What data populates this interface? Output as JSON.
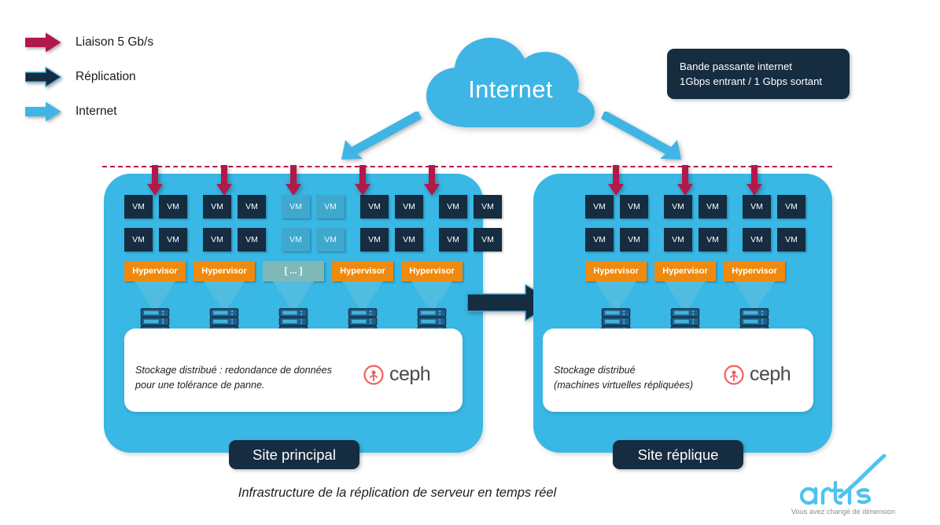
{
  "legend": {
    "items": [
      {
        "label": "Liaison 5 Gb/s",
        "color": "#b3184a",
        "icon": "arrow-right-icon"
      },
      {
        "label": "Réplication",
        "color": "#152c41",
        "icon": "arrow-right-icon"
      },
      {
        "label": "Internet",
        "color": "#3fb5e5",
        "icon": "arrow-right-icon"
      }
    ]
  },
  "cloud": {
    "label": "Internet",
    "color": "#3fb5e5"
  },
  "bandwidth": {
    "line1": "Bande passante internet",
    "line2": "1Gbps entrant / 1 Gbps sortant"
  },
  "sites": {
    "left": {
      "label": "Site principal",
      "vm_label": "VM",
      "vm_row1": [
        {
          "label": "VM",
          "faded": false
        },
        {
          "label": "VM",
          "faded": false
        },
        {
          "label": "VM",
          "faded": false
        },
        {
          "label": "VM",
          "faded": false
        },
        {
          "label": "VM",
          "faded": true
        },
        {
          "label": "VM",
          "faded": true
        },
        {
          "label": "VM",
          "faded": false
        },
        {
          "label": "VM",
          "faded": false
        },
        {
          "label": "VM",
          "faded": false
        },
        {
          "label": "VM",
          "faded": false
        }
      ],
      "vm_row2": [
        {
          "label": "VM",
          "faded": false
        },
        {
          "label": "VM",
          "faded": false
        },
        {
          "label": "VM",
          "faded": false
        },
        {
          "label": "VM",
          "faded": false
        },
        {
          "label": "VM",
          "faded": true
        },
        {
          "label": "VM",
          "faded": true
        },
        {
          "label": "VM",
          "faded": false
        },
        {
          "label": "VM",
          "faded": false
        },
        {
          "label": "VM",
          "faded": false
        },
        {
          "label": "VM",
          "faded": false
        }
      ],
      "hypervisors": [
        {
          "label": "Hypervisor",
          "muted": false
        },
        {
          "label": "Hypervisor",
          "muted": false
        },
        {
          "label": "[ ... ]",
          "muted": true
        },
        {
          "label": "Hypervisor",
          "muted": false
        },
        {
          "label": "Hypervisor",
          "muted": false
        }
      ],
      "server_count": 5,
      "red_arrow_count": 5,
      "storage_text": "Stockage distribué : redondance de données\npour une tolérance de panne.",
      "ceph_label": "ceph"
    },
    "right": {
      "label": "Site réplique",
      "vm_label": "VM",
      "vm_row1": [
        {
          "label": "VM",
          "faded": false
        },
        {
          "label": "VM",
          "faded": false
        },
        {
          "label": "VM",
          "faded": false
        },
        {
          "label": "VM",
          "faded": false
        },
        {
          "label": "VM",
          "faded": false
        },
        {
          "label": "VM",
          "faded": false
        }
      ],
      "vm_row2": [
        {
          "label": "VM",
          "faded": false
        },
        {
          "label": "VM",
          "faded": false
        },
        {
          "label": "VM",
          "faded": false
        },
        {
          "label": "VM",
          "faded": false
        },
        {
          "label": "VM",
          "faded": false
        },
        {
          "label": "VM",
          "faded": false
        }
      ],
      "hypervisors": [
        {
          "label": "Hypervisor",
          "muted": false
        },
        {
          "label": "Hypervisor",
          "muted": false
        },
        {
          "label": "Hypervisor",
          "muted": false
        }
      ],
      "server_count": 3,
      "red_arrow_count": 3,
      "storage_text": "Stockage distribué\n(machines virtuelles répliquées)",
      "ceph_label": "ceph"
    }
  },
  "replication_arrow": {
    "name": "replication-arrow",
    "color": "#152c41"
  },
  "caption": "Infrastructure de la réplication de serveur en temps réel",
  "logo": {
    "name": "artis",
    "tagline": "Vous avez changé de dimension",
    "color": "#3fb5e5"
  },
  "colors": {
    "cyan": "#39b7e5",
    "cloud_cyan": "#3fb5e5",
    "navy": "#152c41",
    "crimson": "#b3184a",
    "orange": "#f08a0e",
    "muted_hyp": "#7fb8b8",
    "faded_vm": "#3fa9cd",
    "ceph_red": "#f0625c",
    "white": "#ffffff"
  }
}
